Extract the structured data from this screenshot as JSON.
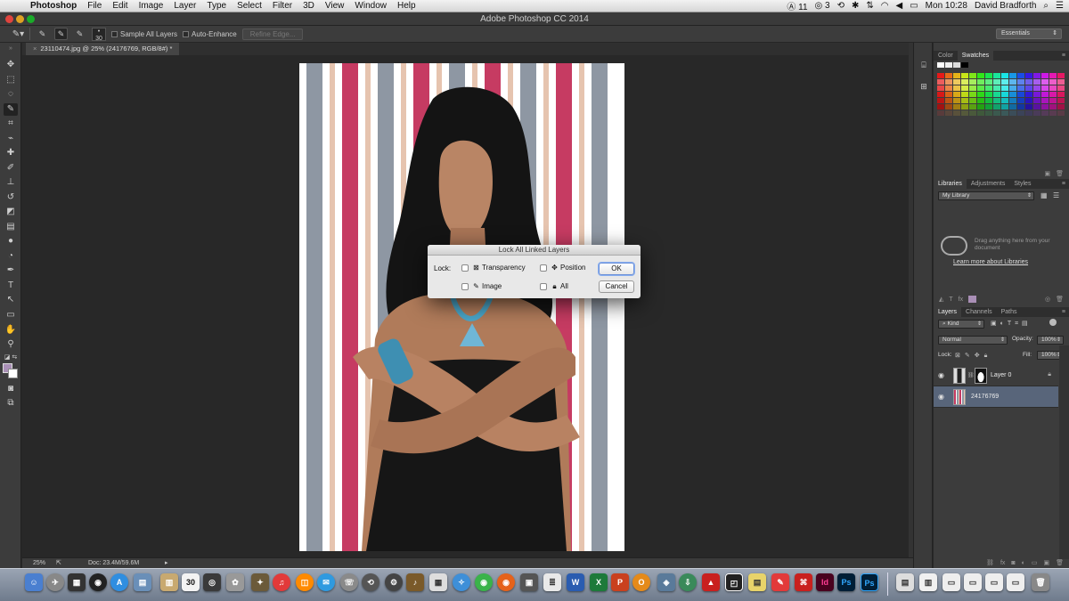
{
  "menubar": {
    "app_name": "Photoshop",
    "items": [
      "File",
      "Edit",
      "Image",
      "Layer",
      "Type",
      "Select",
      "Filter",
      "3D",
      "View",
      "Window",
      "Help"
    ],
    "status": {
      "notif_count": "11",
      "cc_count": "3",
      "clock": "Mon 10:28",
      "user": "David Bradforth"
    }
  },
  "window": {
    "title": "Adobe Photoshop CC 2014"
  },
  "options_bar": {
    "brush_size": "30",
    "sample_all_layers": "Sample All Layers",
    "auto_enhance": "Auto-Enhance",
    "refine_edge": "Refine Edge...",
    "workspace": "Essentials"
  },
  "document": {
    "tab_label": "23110474.jpg @ 25% (24176769, RGB/8#) *",
    "stripe_colors": {
      "pink": "#c63b62",
      "peach": "#e6c4af",
      "gray": "#8e97a3",
      "white": "#ffffff"
    }
  },
  "dialog": {
    "title": "Lock All Linked Layers",
    "lock_label": "Lock:",
    "options": {
      "transparency": "Transparency",
      "position": "Position",
      "image": "Image",
      "all": "All"
    },
    "ok": "OK",
    "cancel": "Cancel"
  },
  "status_bar": {
    "zoom": "25%",
    "doc_size": "Doc: 23.4M/59.6M"
  },
  "panels": {
    "color_tabs": [
      "Color",
      "Swatches"
    ],
    "libraries_tabs": [
      "Libraries",
      "Adjustments",
      "Styles"
    ],
    "library_select": "My Library",
    "library_empty": "Drag anything here from your document",
    "library_link": "Learn more about Libraries",
    "layers_tabs": [
      "Layers",
      "Channels",
      "Paths"
    ],
    "filter_kind": "Kind",
    "blend_mode": "Normal",
    "opacity_label": "Opacity:",
    "opacity_value": "100%",
    "lock_label": "Lock:",
    "fill_label": "Fill:",
    "fill_value": "100%",
    "layers": [
      {
        "name": "Layer 0",
        "selected": false
      },
      {
        "name": "24176769",
        "selected": true
      }
    ]
  },
  "dock": {
    "calendar_day": "30"
  }
}
